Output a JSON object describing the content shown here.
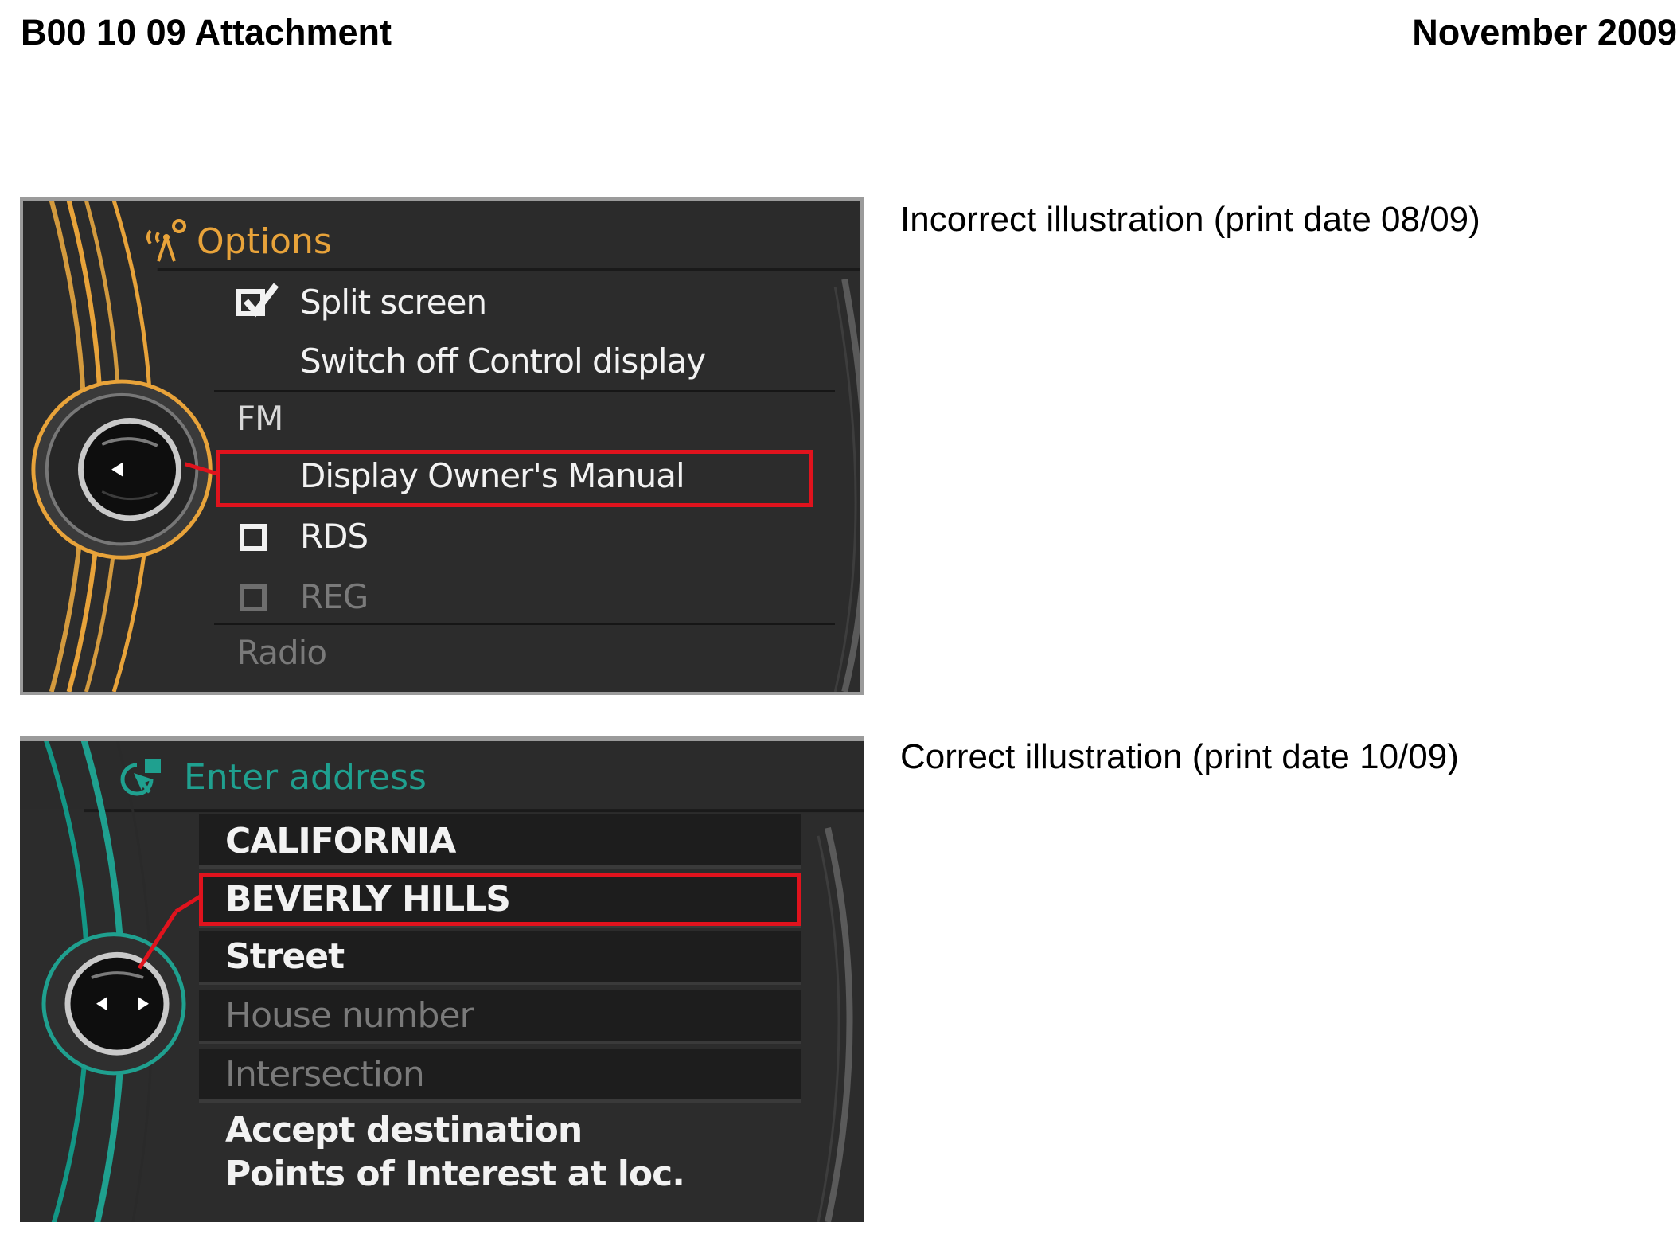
{
  "header": {
    "left": "B00 10 09 Attachment",
    "right": "November 2009"
  },
  "captions": {
    "incorrect": "Incorrect illustration (print date 08/09)",
    "correct": "Correct illustration (print date 10/09)"
  },
  "options_screen": {
    "title": "Options",
    "accent_color": "#e8a33a",
    "title_icon": "antenna-settings-icon",
    "items": [
      {
        "label": "Split screen",
        "state": "checked"
      },
      {
        "label": "Switch off Control display",
        "state": "normal"
      },
      {
        "label": "FM",
        "state": "section"
      },
      {
        "label": "Display Owner's Manual",
        "state": "highlighted"
      },
      {
        "label": "RDS",
        "state": "unchecked"
      },
      {
        "label": "REG",
        "state": "disabled"
      },
      {
        "label": "Radio",
        "state": "section-disabled"
      }
    ]
  },
  "address_screen": {
    "title": "Enter address",
    "accent_color": "#1fa08f",
    "title_icon": "navigation-address-icon",
    "items": [
      {
        "label": "CALIFORNIA",
        "state": "normal"
      },
      {
        "label": "BEVERLY HILLS",
        "state": "highlighted"
      },
      {
        "label": "Street",
        "state": "normal"
      },
      {
        "label": "House number",
        "state": "disabled"
      },
      {
        "label": "Intersection",
        "state": "disabled"
      },
      {
        "label": "Accept destination",
        "state": "normal"
      },
      {
        "label": "Points of Interest at loc.",
        "state": "normal"
      }
    ]
  },
  "highlight_color": "#e0131d"
}
